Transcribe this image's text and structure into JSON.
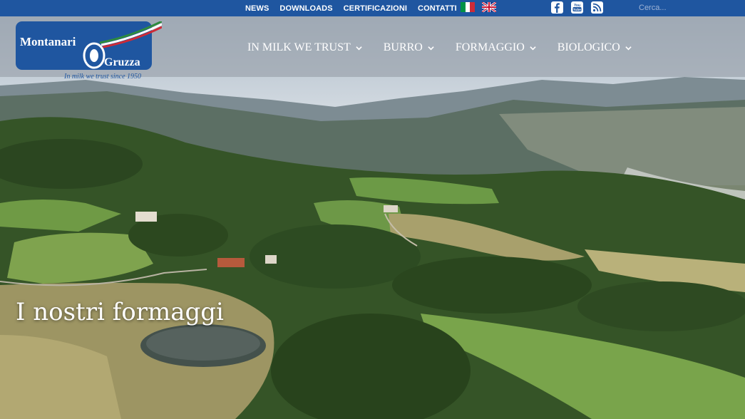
{
  "topbar": {
    "links": [
      "NEWS",
      "DOWNLOADS",
      "CERTIFICAZIONI",
      "CONTATTI"
    ],
    "language_flags": [
      {
        "name": "italian-flag-icon",
        "colors": [
          "#009246",
          "#ffffff",
          "#ce2b37"
        ]
      },
      {
        "name": "uk-flag-icon",
        "colors": [
          "#1e3a8a",
          "#ffffff",
          "#c8102e"
        ]
      }
    ],
    "social_icons": [
      "facebook-icon",
      "youtube-icon",
      "rss-icon"
    ],
    "search": {
      "placeholder": "Cerca..."
    },
    "background_color": "#1f56a0"
  },
  "logo": {
    "text_left": "Montanari",
    "text_right": "Gruzza",
    "tagline": "In milk we trust since 1950",
    "box_color": "#1f56a0"
  },
  "nav": {
    "items": [
      {
        "label": "IN MILK WE TRUST"
      },
      {
        "label": "BURRO"
      },
      {
        "label": "FORMAGGIO"
      },
      {
        "label": "BIOLOGICO"
      }
    ]
  },
  "hero": {
    "title": "I nostri formaggi",
    "image": "aerial-landscape-image"
  }
}
